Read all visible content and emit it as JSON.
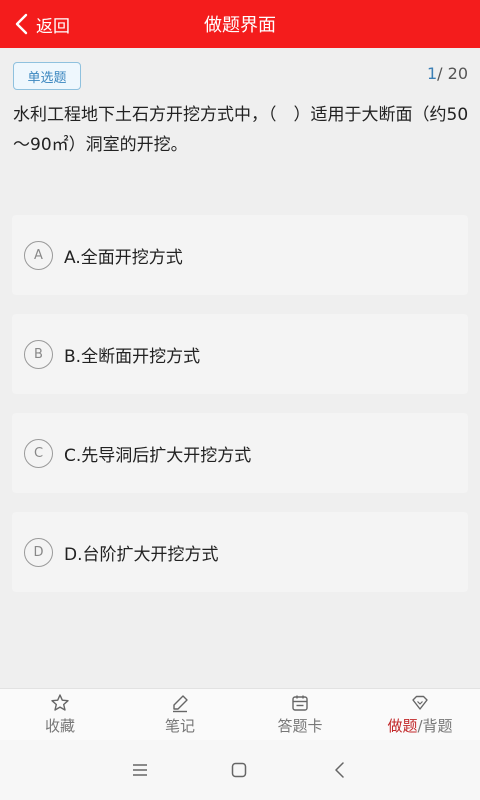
{
  "header": {
    "back_label": "返回",
    "title": "做题界面",
    "color": "#f41c1c"
  },
  "question": {
    "type_badge": "单选题",
    "current": "1",
    "total": "/ 20",
    "stem": "水利工程地下土石方开挖方式中，（　）适用于大断面（约50～90㎡）洞室的开挖。"
  },
  "options": [
    {
      "letter": "A",
      "text": "A.全面开挖方式"
    },
    {
      "letter": "B",
      "text": "B.全断面开挖方式"
    },
    {
      "letter": "C",
      "text": "C.先导洞后扩大开挖方式"
    },
    {
      "letter": "D",
      "text": "D.台阶扩大开挖方式"
    }
  ],
  "bottom_nav": {
    "favorite": "收藏",
    "notes": "笔记",
    "answer_card": "答题卡",
    "mode_active": "做题",
    "mode_sep": "/",
    "mode_other": "背题",
    "active_color": "#c2282a"
  },
  "system_nav": {
    "icons": [
      "menu-icon",
      "home-icon",
      "back-icon"
    ]
  }
}
